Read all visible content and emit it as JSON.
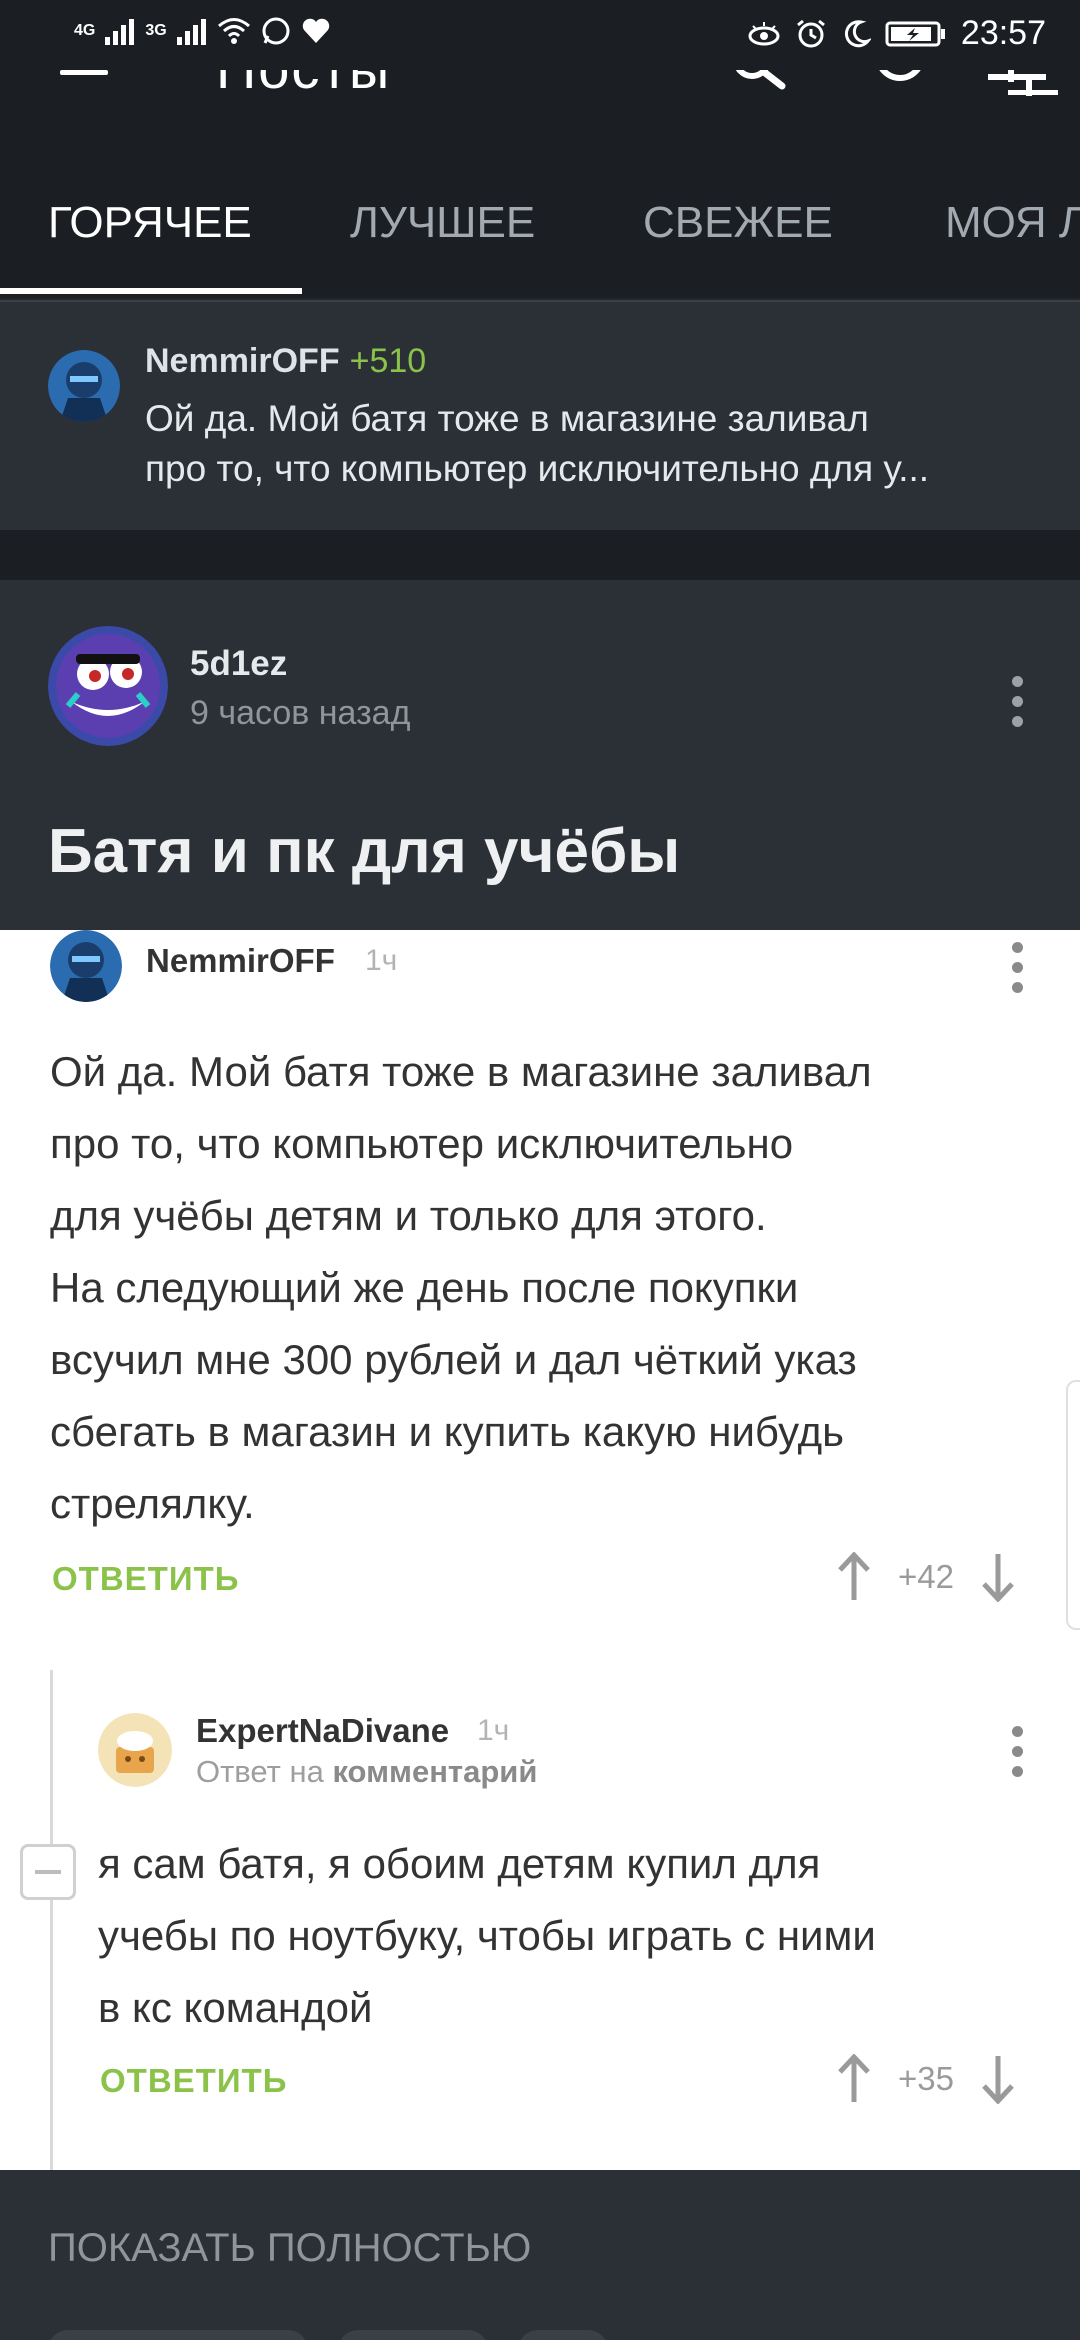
{
  "status_bar": {
    "network1": "4G",
    "network2": "3G",
    "time": "23:57"
  },
  "app_bar": {
    "title": "Посты"
  },
  "tabs": [
    {
      "label": "ГОРЯЧЕЕ",
      "active": true
    },
    {
      "label": "ЛУЧШЕЕ",
      "active": false
    },
    {
      "label": "СВЕЖЕЕ",
      "active": false
    },
    {
      "label": "МОЯ Л",
      "active": false
    }
  ],
  "pinned_comment": {
    "author": "NemmirOFF",
    "rating": "+510",
    "line1": "Ой да. Мой батя тоже в магазине заливал",
    "line2": "про то, что компьютер исключительно для у..."
  },
  "post": {
    "author": "5d1ez",
    "time": "9 часов назад",
    "title": "Батя и пк для учёбы"
  },
  "image_comments": {
    "comment1": {
      "author": "NemmirOFF",
      "time": "1ч",
      "lines": [
        "Ой да. Мой батя тоже в магазине заливал",
        "про то, что компьютер исключительно",
        "для учёбы детям и только для этого.",
        "На следующий же день после покупки",
        "всучил мне 300 рублей и дал чёткий указ",
        "сбегать в магазин и купить какую нибудь",
        "стрелялку."
      ],
      "reply_label": "ОТВЕТИТЬ",
      "votes": "+42"
    },
    "comment2": {
      "author": "ExpertNaDivane",
      "time": "1ч",
      "reply_prefix": "Ответ на",
      "reply_target": "комментарий",
      "lines": [
        "я сам батя, я обоим детям купил для",
        "учебы по ноутбуку, чтобы играть с ними",
        "в кс командой"
      ],
      "reply_label": "ОТВЕТИТЬ",
      "votes": "+35"
    }
  },
  "show_full": {
    "label": "ПОКАЗАТЬ ПОЛНОСТЬЮ"
  },
  "colors": {
    "accent_green": "#8bc34a",
    "bg_dark": "#1b1f23",
    "card_dark": "#2b3036"
  }
}
